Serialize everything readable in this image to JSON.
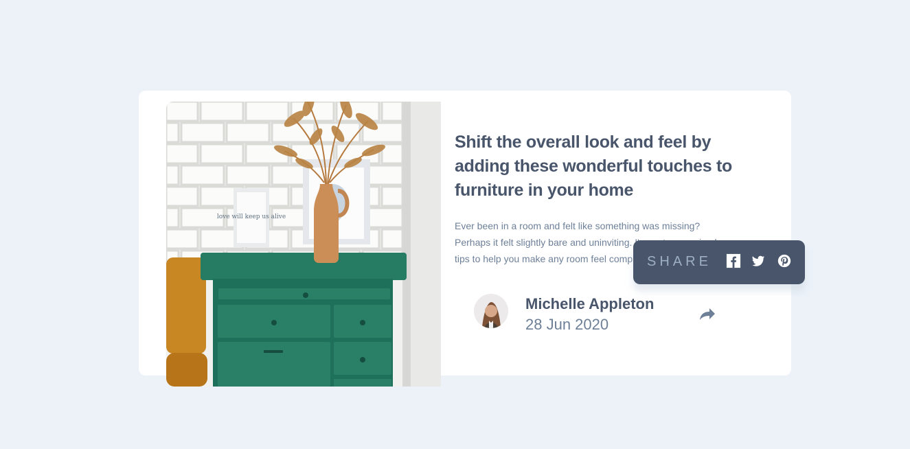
{
  "article": {
    "title": "Shift the overall look and feel by adding these wonderful touches to furniture in your home",
    "description": "Ever been in a room and felt like something was missing? Perhaps it felt slightly bare and uninviting. I've got some simple tips to help you make any room feel complete.",
    "image_alt": "drawers",
    "frame_text": "love will keep us alive"
  },
  "author": {
    "name": "Michelle Appleton",
    "date": "28 Jun 2020"
  },
  "share": {
    "label": "SHARE",
    "icons": [
      "facebook-icon",
      "twitter-icon",
      "pinterest-icon"
    ]
  },
  "colors": {
    "page_background": "#ecf2f8",
    "card_background": "#ffffff",
    "title": "#48556a",
    "text": "#6e8098",
    "share_background": "#48556a",
    "share_label": "#9eafc2"
  }
}
